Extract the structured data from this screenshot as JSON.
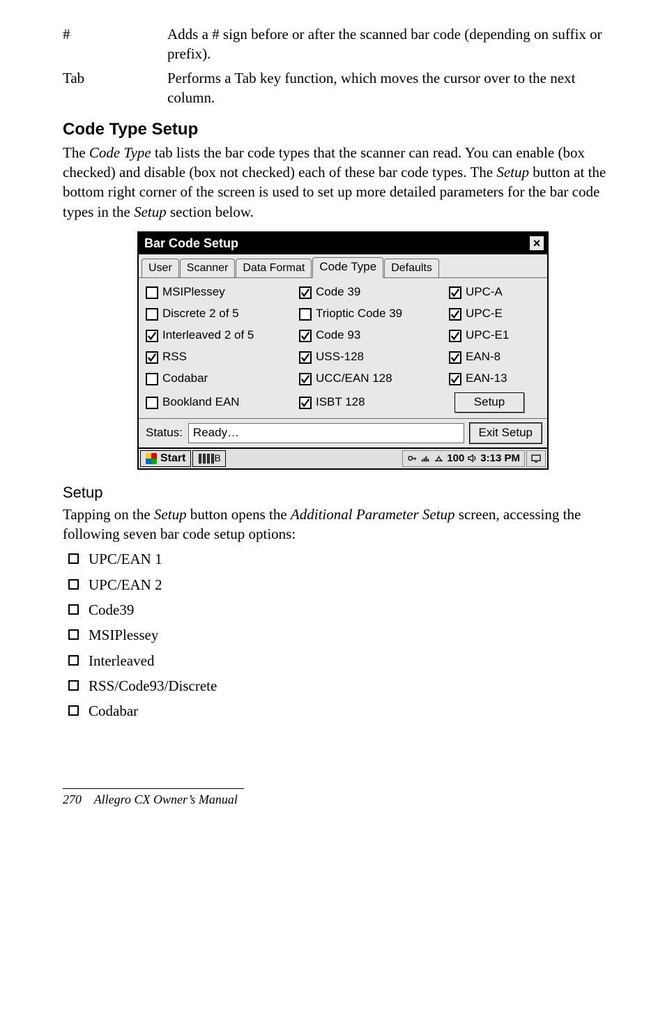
{
  "defs": [
    {
      "term": "#",
      "desc": "Adds a # sign before or after the scanned bar code (depending on suffix or prefix)."
    },
    {
      "term": "Tab",
      "desc": "Performs a Tab key function, which moves the cursor over to the next column."
    }
  ],
  "heading_codetype": "Code Type Setup",
  "para_codetype_pre": "The ",
  "para_codetype_em1": "Code Type",
  "para_codetype_mid1": " tab lists the bar code types that the scanner can read. You can enable (box checked) and disable (box not checked) each of these bar code types. The ",
  "para_codetype_em2": "Setup",
  "para_codetype_mid2": " button at the bottom right corner of the screen is used to set up more detailed parameters for the bar code types in the ",
  "para_codetype_em3": "Setup",
  "para_codetype_post": " section below.",
  "dialog": {
    "title": "Bar Code Setup",
    "tabs": [
      "User",
      "Scanner",
      "Data Format",
      "Code Type",
      "Defaults"
    ],
    "active_tab_index": 3,
    "columns": [
      [
        {
          "label": "MSIPlessey",
          "checked": false
        },
        {
          "label": "Discrete 2 of 5",
          "checked": false
        },
        {
          "label": "Interleaved 2 of 5",
          "checked": true
        },
        {
          "label": "RSS",
          "checked": true
        },
        {
          "label": "Codabar",
          "checked": false
        },
        {
          "label": "Bookland EAN",
          "checked": false
        }
      ],
      [
        {
          "label": "Code 39",
          "checked": true
        },
        {
          "label": "Trioptic Code 39",
          "checked": false
        },
        {
          "label": "Code 93",
          "checked": true
        },
        {
          "label": "USS-128",
          "checked": true
        },
        {
          "label": "UCC/EAN 128",
          "checked": true
        },
        {
          "label": "ISBT 128",
          "checked": true
        }
      ],
      [
        {
          "label": "UPC-A",
          "checked": true
        },
        {
          "label": "UPC-E",
          "checked": true
        },
        {
          "label": "UPC-E1",
          "checked": true
        },
        {
          "label": "EAN-8",
          "checked": true
        },
        {
          "label": "EAN-13",
          "checked": true
        }
      ]
    ],
    "setup_button": "Setup",
    "status_label": "Status:",
    "status_value": "Ready…",
    "exit_button": "Exit Setup",
    "taskbar": {
      "start": "Start",
      "app_hint": "B",
      "battery_text": "100",
      "clock": "3:13 PM"
    }
  },
  "heading_setup": "Setup",
  "para_setup_pre": "Tapping on the ",
  "para_setup_em1": "Setup",
  "para_setup_mid1": " button opens the ",
  "para_setup_em2": "Additional Parameter Setup",
  "para_setup_post": " screen, accessing the following seven bar code setup options:",
  "checklist": [
    "UPC/EAN 1",
    "UPC/EAN 2",
    "Code39",
    "MSIPlessey",
    "Interleaved",
    "RSS/Code93/Discrete",
    "Codabar"
  ],
  "footer_page": "270",
  "footer_title": "Allegro CX Owner’s Manual"
}
